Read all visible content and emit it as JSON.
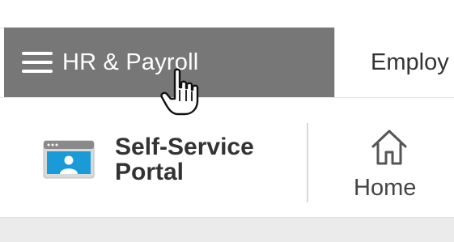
{
  "nav": {
    "menu_label": "HR & Payroll",
    "next_tab_label": "Employ",
    "menu_icon": "hamburger-icon",
    "active_bg": "#777777"
  },
  "cursor": {
    "icon": "hand-pointer-cursor"
  },
  "header": {
    "portal_title_line1": "Self-Service",
    "portal_title_line2": "Portal",
    "portal_icon": "portal-id-card-icon",
    "portal_icon_color": "#1a9ad6",
    "home_label": "Home",
    "home_icon": "home-icon"
  }
}
